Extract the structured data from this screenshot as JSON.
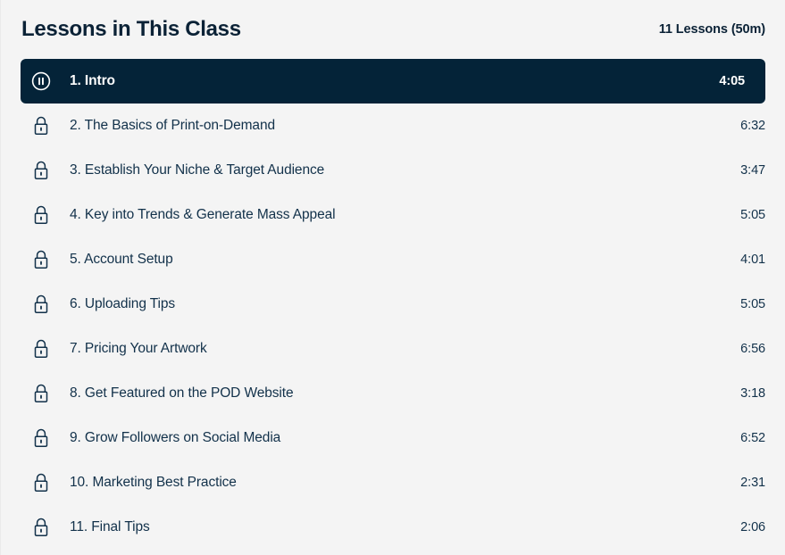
{
  "header": {
    "title": "Lessons in This Class",
    "count_label": "11 Lessons (50m)"
  },
  "colors": {
    "page_background": "#f4f4f4",
    "active_row_background": "#042338",
    "text_primary": "#12314a",
    "title_color": "#0b2236",
    "active_text": "#ffffff"
  },
  "lessons": [
    {
      "title": "1. Intro",
      "duration": "4:05",
      "state": "playing",
      "icon": "pause-circle-icon"
    },
    {
      "title": "2. The Basics of Print-on-Demand",
      "duration": "6:32",
      "state": "locked",
      "icon": "lock-icon"
    },
    {
      "title": "3. Establish Your Niche & Target Audience",
      "duration": "3:47",
      "state": "locked",
      "icon": "lock-icon"
    },
    {
      "title": "4. Key into Trends & Generate Mass Appeal",
      "duration": "5:05",
      "state": "locked",
      "icon": "lock-icon"
    },
    {
      "title": "5. Account Setup",
      "duration": "4:01",
      "state": "locked",
      "icon": "lock-icon"
    },
    {
      "title": "6. Uploading Tips",
      "duration": "5:05",
      "state": "locked",
      "icon": "lock-icon"
    },
    {
      "title": "7. Pricing Your Artwork",
      "duration": "6:56",
      "state": "locked",
      "icon": "lock-icon"
    },
    {
      "title": "8. Get Featured on the POD Website",
      "duration": "3:18",
      "state": "locked",
      "icon": "lock-icon"
    },
    {
      "title": "9. Grow Followers on Social Media",
      "duration": "6:52",
      "state": "locked",
      "icon": "lock-icon"
    },
    {
      "title": "10. Marketing Best Practice",
      "duration": "2:31",
      "state": "locked",
      "icon": "lock-icon"
    },
    {
      "title": "11. Final Tips",
      "duration": "2:06",
      "state": "locked",
      "icon": "lock-icon"
    }
  ]
}
